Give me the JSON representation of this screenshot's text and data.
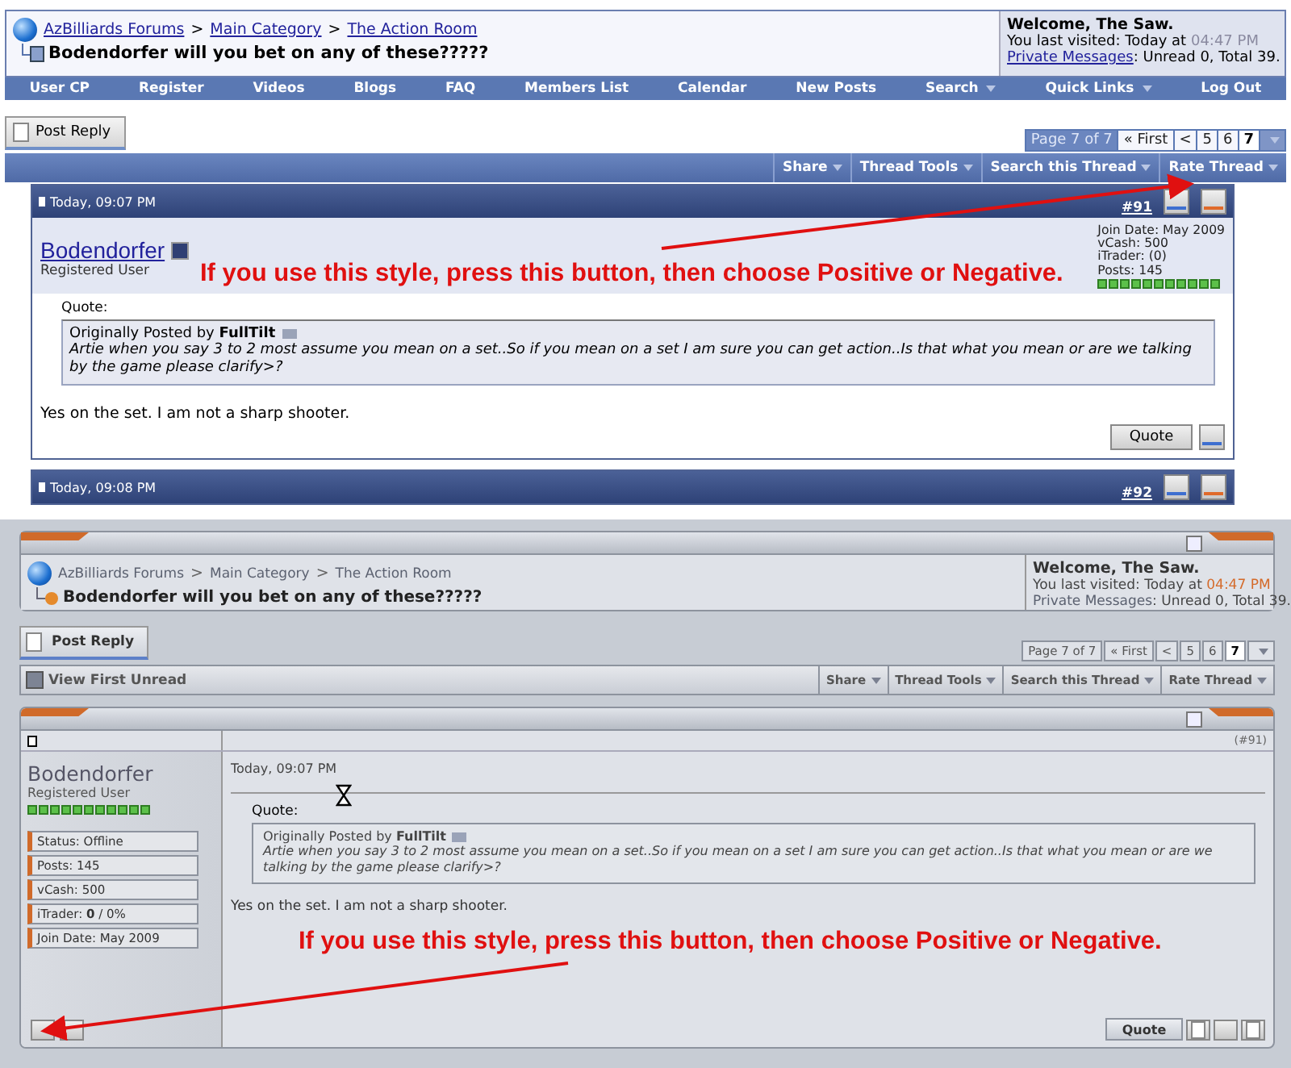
{
  "blue_style": {
    "breadcrumb": {
      "separator": ">",
      "links": [
        "AzBilliards Forums",
        "Main Category",
        "The Action Room"
      ]
    },
    "thread_title": "Bodendorfer will you bet on any of these?????",
    "welcome": {
      "greeting": "Welcome, The Saw.",
      "last_visited": "You last visited: Today at",
      "time": "04:47 PM",
      "messages_link": "Private Messages",
      "messages_counts": ": Unread 0, Total 39."
    },
    "nav": [
      {
        "label": "User CP",
        "has_menu": false
      },
      {
        "label": "Register",
        "has_menu": false
      },
      {
        "label": "Videos",
        "has_menu": false
      },
      {
        "label": "Blogs",
        "has_menu": false
      },
      {
        "label": "FAQ",
        "has_menu": false
      },
      {
        "label": "Members List",
        "has_menu": false
      },
      {
        "label": "Calendar",
        "has_menu": false
      },
      {
        "label": "New Posts",
        "has_menu": false
      },
      {
        "label": "Search",
        "has_menu": true
      },
      {
        "label": "Quick Links",
        "has_menu": true
      },
      {
        "label": "Log Out",
        "has_menu": false
      }
    ],
    "post_reply": "Post Reply",
    "pagination": {
      "label": "Page 7 of 7",
      "first": "« First",
      "prev": "<",
      "pages": [
        {
          "label": "5",
          "selected": false
        },
        {
          "label": "6",
          "selected": false
        },
        {
          "label": "7",
          "selected": true
        }
      ]
    },
    "thread_tools": [
      {
        "label": "Share",
        "has_menu": true
      },
      {
        "label": "Thread Tools",
        "has_menu": true
      },
      {
        "label": "Search this Thread",
        "has_menu": true
      },
      {
        "label": "Rate Thread",
        "has_menu": true
      }
    ],
    "post": {
      "date": "Today, 09:07 PM",
      "number": "#91",
      "author": "Bodendorfer",
      "user_title": "Registered User",
      "stats": [
        "Join Date: May 2009",
        "vCash: 500",
        "iTrader: (0)",
        "Posts: 145"
      ],
      "quote_label": "Quote:",
      "quote_source": "Originally Posted by **FullTilt**",
      "quote_text": "Artie when you say 3 to 2 most assume you mean on a set..So if you mean on a set I am sure you can get action..Is that what you mean or are we talking by the game please clarify>?",
      "message": "Yes on the set. I am not a sharp shooter.",
      "quote_button": "Quote"
    },
    "next_post": {
      "date": "Today, 09:08 PM",
      "number": "#92"
    },
    "annotation": "If you use this style, press this button, then choose Positive or Negative."
  },
  "grey_style": {
    "breadcrumb": {
      "separator": ">",
      "links": [
        "AzBilliards Forums",
        "Main Category",
        "The Action Room"
      ]
    },
    "thread_title": "Bodendorfer will you bet on any of these?????",
    "welcome": {
      "greeting": "Welcome, The Saw.",
      "last_visited": "You last visited: Today at",
      "time": "04:47 PM",
      "messages_link": "Private Messages",
      "messages_counts": ": Unread 0, Total 39."
    },
    "post_reply": "Post Reply",
    "pagination": {
      "label": "Page 7 of 7",
      "first": "« First",
      "prev": "<",
      "pages": [
        {
          "label": "5",
          "selected": false
        },
        {
          "label": "6",
          "selected": false
        },
        {
          "label": "7",
          "selected": true
        }
      ]
    },
    "view_first_unread": "View First Unread",
    "thread_tools": [
      {
        "label": "Share",
        "has_menu": true
      },
      {
        "label": "Thread Tools",
        "has_menu": true
      },
      {
        "label": "Search this Thread",
        "has_menu": true
      },
      {
        "label": "Rate Thread",
        "has_menu": true
      }
    ],
    "post": {
      "date": "Today, 09:07 PM",
      "number": "(#91)",
      "author": "Bodendorfer",
      "user_title": "Registered User",
      "stats": [
        "Status: Offline",
        "Posts: 145",
        "vCash: 500",
        "iTrader: **0** / 0%",
        "Join Date: May 2009"
      ],
      "quote_label": "Quote:",
      "quote_source": "Originally Posted by **FullTilt**",
      "quote_text": "Artie when you say 3 to 2 most assume you mean on a set..So if you mean on a set I am sure you can get action..Is that what you mean or are we talking by the game please clarify>?",
      "message": "Yes on the set. I am not a sharp shooter.",
      "quote_button": "Quote"
    },
    "annotation": "If you use this style, press this button, then choose Positive or Negative."
  }
}
